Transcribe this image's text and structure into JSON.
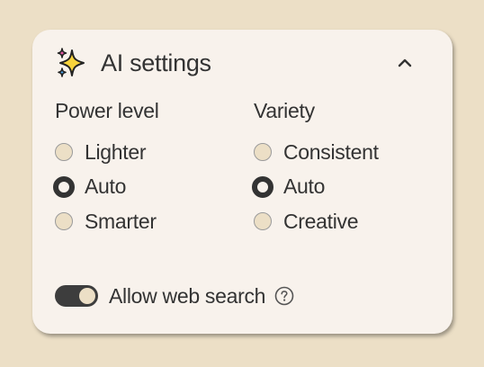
{
  "panel": {
    "title": "AI settings",
    "icon": "sparkle-icon",
    "collapse_icon": "chevron-up-icon"
  },
  "power_level": {
    "title": "Power level",
    "options": [
      {
        "label": "Lighter",
        "selected": false
      },
      {
        "label": "Auto",
        "selected": true
      },
      {
        "label": "Smarter",
        "selected": false
      }
    ]
  },
  "variety": {
    "title": "Variety",
    "options": [
      {
        "label": "Consistent",
        "selected": false
      },
      {
        "label": "Auto",
        "selected": true
      },
      {
        "label": "Creative",
        "selected": false
      }
    ]
  },
  "web_search": {
    "label": "Allow web search",
    "enabled": true,
    "help_icon": "help-icon"
  },
  "colors": {
    "background": "#ecdfc6",
    "panel": "#f8f2ec",
    "text": "#333333",
    "toggle_on": "#3d3d3d"
  }
}
